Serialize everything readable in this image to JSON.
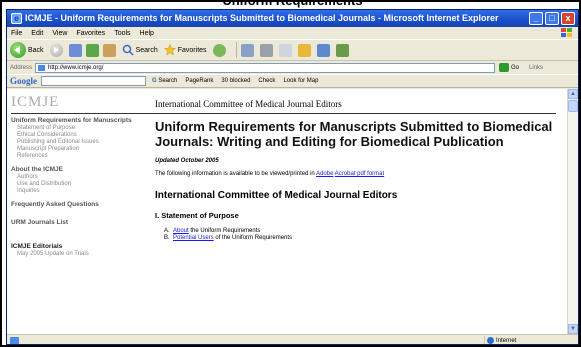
{
  "slide": {
    "title": "Uniform Requirements"
  },
  "window": {
    "title": "ICMJE - Uniform Requirements for Manuscripts Submitted to Biomedical Journals - Microsoft Internet Explorer",
    "buttons": {
      "minimize": "_",
      "maximize": "□",
      "close": "x"
    }
  },
  "menu": [
    "File",
    "Edit",
    "View",
    "Favorites",
    "Tools",
    "Help"
  ],
  "toolbar": {
    "back": "Back",
    "search": "Search",
    "favorites": "Favorites"
  },
  "address": {
    "label": "Address",
    "url": "http://www.icmje.org/",
    "go": "Go",
    "links": "Links"
  },
  "googlebar": {
    "logo": "Google",
    "search": "Search",
    "pagerank": "PageRank",
    "blocked": "30 blocked",
    "check": "Check",
    "lookfor": "Look for Map"
  },
  "site": {
    "logo": "ICMJE",
    "header": "International Committee of Medical Journal Editors"
  },
  "nav": [
    {
      "heading": "Uniform Requirements for Manuscripts",
      "items": [
        "Statement of Purpose",
        "Ethical Considerations",
        "Publishing and Editorial Issues",
        "Manuscript Preparation",
        "References"
      ]
    },
    {
      "heading": "About the ICMJE",
      "items": [
        "Authors",
        "Use and Distribution",
        "Inquiries"
      ]
    },
    {
      "heading": "Frequently Asked Questions",
      "items": []
    },
    {
      "heading": "URM Journals List",
      "items": []
    },
    {
      "heading": "ICMJE Editorials",
      "items": [
        "May 2005 Update on Trials"
      ]
    }
  ],
  "main": {
    "title": "Uniform Requirements for Manuscripts Submitted to Biomedical Journals: Writing and Editing for Biomedical Publication",
    "updated": "Updated October 2005",
    "avail_text": "The following information is available to be viewed/printed in ",
    "avail_link1": "Adobe",
    "avail_link2": "Acrobat pdf format",
    "section_title": "International Committee of Medical Journal Editors",
    "section_heading": "I. Statement of Purpose",
    "list": [
      {
        "marker": "A.",
        "link": "About",
        "text": " the Uniform Requirements"
      },
      {
        "marker": "B.",
        "link": "Potential Users",
        "text": " of the Uniform Requirements"
      }
    ]
  },
  "status": {
    "zone": "Internet"
  }
}
